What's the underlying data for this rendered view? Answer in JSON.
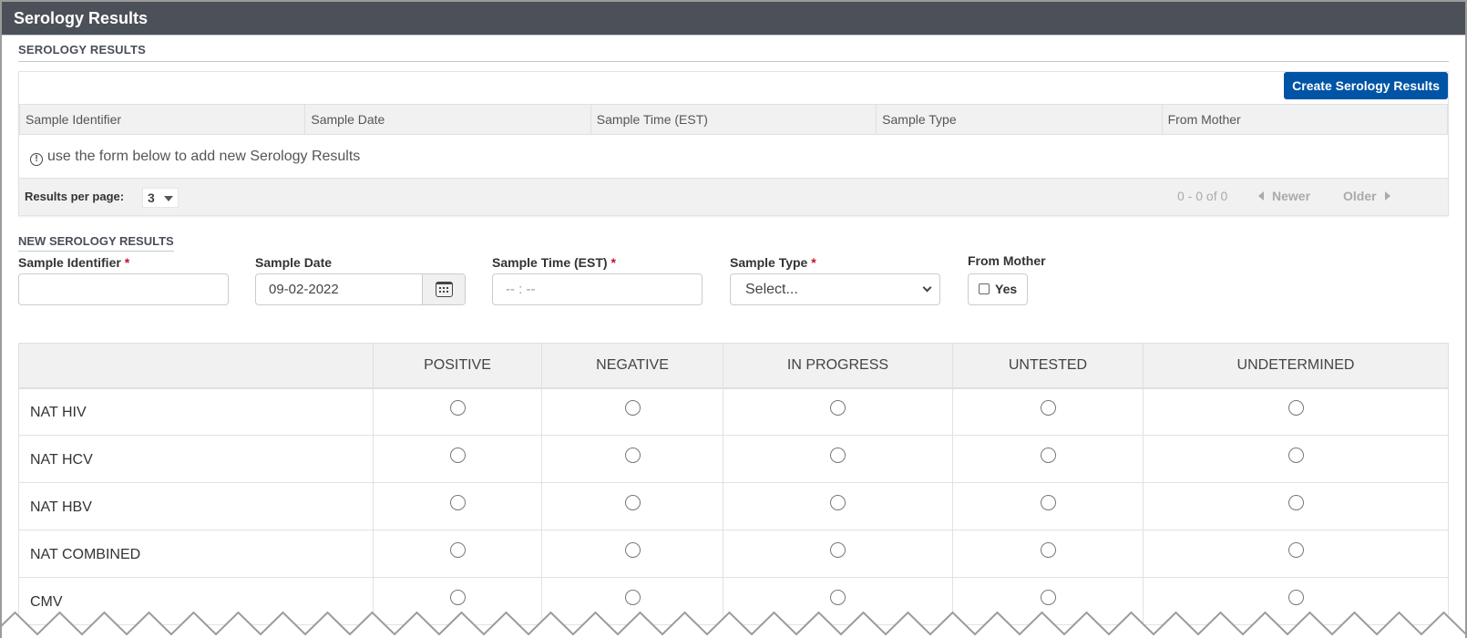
{
  "window": {
    "title": "Serology Results"
  },
  "list_section": {
    "title": "SEROLOGY RESULTS",
    "create_button": "Create Serology Results",
    "columns": [
      "Sample Identifier",
      "Sample Date",
      "Sample Time (EST)",
      "Sample Type",
      "From Mother"
    ],
    "empty_message": "use the form below to add new Serology Results",
    "pager": {
      "results_per_page_label": "Results per page:",
      "results_per_page_value": "3",
      "range": "0 - 0 of 0",
      "newer_label": "Newer",
      "older_label": "Older"
    }
  },
  "form": {
    "title": "NEW SEROLOGY RESULTS",
    "required_marker": "*",
    "fields": {
      "sample_identifier": {
        "label": "Sample Identifier",
        "value": "",
        "required": true
      },
      "sample_date": {
        "label": "Sample Date",
        "value": "09-02-2022",
        "required": false
      },
      "sample_time": {
        "label": "Sample Time (EST)",
        "placeholder": "-- : --",
        "required": true
      },
      "sample_type": {
        "label": "Sample Type",
        "value": "Select...",
        "required": true
      },
      "from_mother": {
        "label": "From Mother",
        "option_label": "Yes",
        "checked": false
      }
    }
  },
  "results_grid": {
    "columns": [
      "POSITIVE",
      "NEGATIVE",
      "IN PROGRESS",
      "UNTESTED",
      "UNDETERMINED"
    ],
    "rows": [
      {
        "label": "NAT HIV",
        "selected": null
      },
      {
        "label": "NAT HCV",
        "selected": null
      },
      {
        "label": "NAT HBV",
        "selected": null
      },
      {
        "label": "NAT COMBINED",
        "selected": null
      },
      {
        "label": "CMV",
        "selected": null
      }
    ]
  },
  "colors": {
    "titlebar": "#4c5058",
    "primary_button": "#0054a6",
    "required": "#c8102e"
  }
}
